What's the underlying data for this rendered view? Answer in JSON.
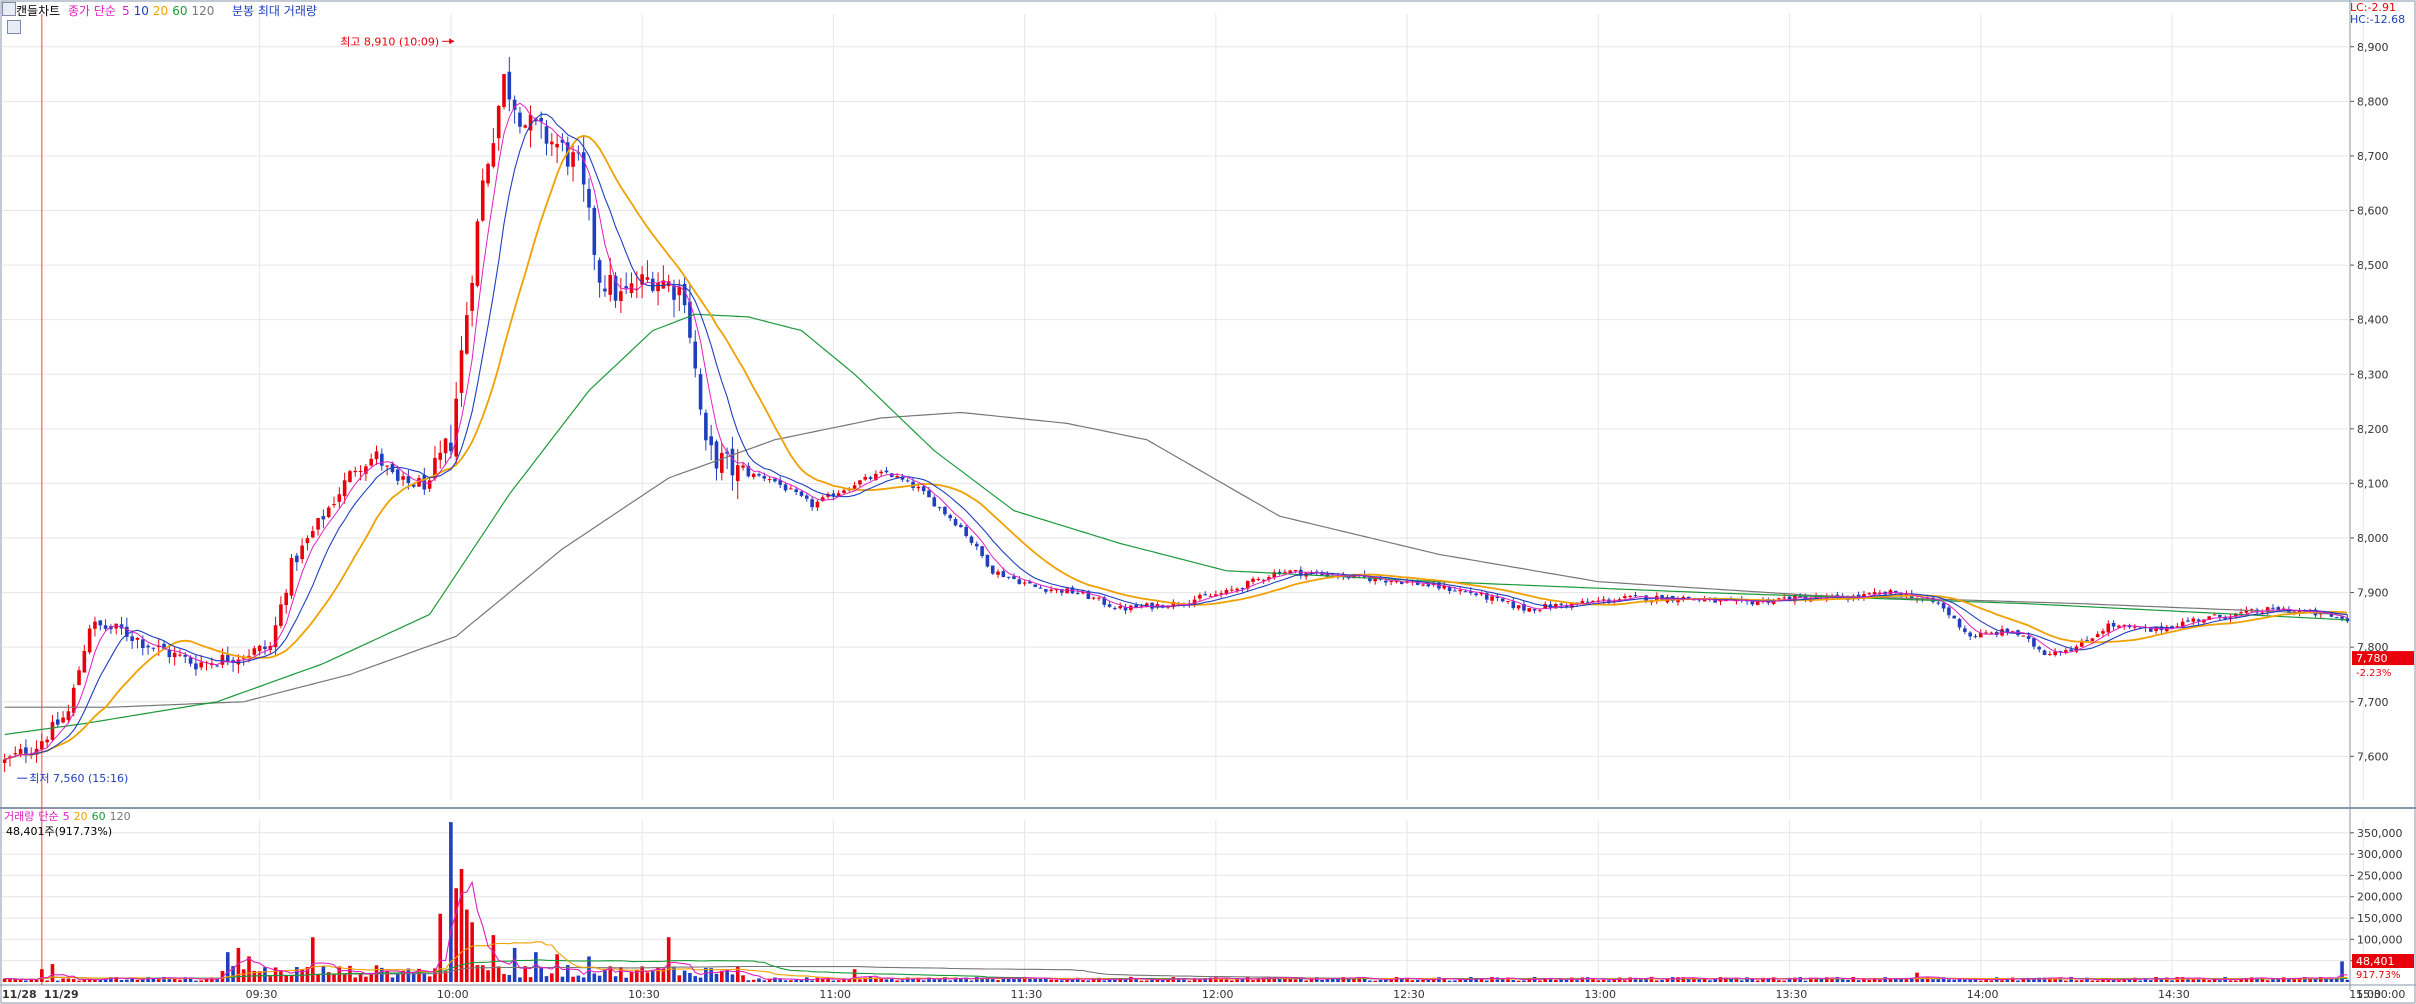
{
  "toolbar": {
    "chart_type_label": "캔들차트",
    "price_ma_label": "종가 단순",
    "price_ma_periods": [
      "5",
      "10",
      "20",
      "60",
      "120"
    ],
    "extra_label": "분봉 최대 거래량",
    "lc": "LC:-2.91",
    "hc": "HC:-12.68"
  },
  "volume_header": {
    "label": "거래량",
    "ma_label": "단순",
    "periods": [
      "5",
      "20",
      "60",
      "120"
    ],
    "value_text": "48,401주(917.73%)"
  },
  "colors": {
    "up": "#e8000b",
    "down": "#1f3fbf",
    "ma5": "#e020c0",
    "ma10": "#1f3fbf",
    "ma20": "#f0a000",
    "ma60": "#1a9a3a",
    "ma120": "#777777",
    "grid": "#e6e6e6",
    "vline": "#ff4040"
  },
  "chart_data": [
    {
      "type": "candlestick",
      "name": "price",
      "ylim": [
        7520,
        8960
      ],
      "y_ticks": [
        "8,900",
        "8,800",
        "8,700",
        "8,600",
        "8,500",
        "8,400",
        "8,300",
        "8,200",
        "8,100",
        "8,000",
        "7,900",
        "7,800",
        "7,700",
        "7,600"
      ],
      "y_tick_values": [
        8900,
        8800,
        8700,
        8600,
        8500,
        8400,
        8300,
        8200,
        8100,
        8000,
        7900,
        7800,
        7700,
        7600
      ],
      "x_labels": [
        "11/28",
        "11/29",
        "09:30",
        "10:00",
        "10:30",
        "11:00",
        "11:30",
        "12:00",
        "12:30",
        "13:00",
        "13:30",
        "14:00",
        "14:30",
        "15:00",
        "15:30:00"
      ],
      "anchors": [
        {
          "t": 0,
          "v": 7590
        },
        {
          "t": 6,
          "v": 7620
        },
        {
          "t": 12,
          "v": 7680
        },
        {
          "t": 16,
          "v": 7840
        },
        {
          "t": 22,
          "v": 7830
        },
        {
          "t": 28,
          "v": 7800
        },
        {
          "t": 36,
          "v": 7770
        },
        {
          "t": 42,
          "v": 7780
        },
        {
          "t": 50,
          "v": 7800
        },
        {
          "t": 54,
          "v": 7950
        },
        {
          "t": 60,
          "v": 8040
        },
        {
          "t": 66,
          "v": 8130
        },
        {
          "t": 70,
          "v": 8150
        },
        {
          "t": 74,
          "v": 8100
        },
        {
          "t": 80,
          "v": 8100
        },
        {
          "t": 84,
          "v": 8180
        },
        {
          "t": 90,
          "v": 8650
        },
        {
          "t": 94,
          "v": 8840
        },
        {
          "t": 98,
          "v": 8760
        },
        {
          "t": 104,
          "v": 8720
        },
        {
          "t": 108,
          "v": 8680
        },
        {
          "t": 112,
          "v": 8480
        },
        {
          "t": 116,
          "v": 8440
        },
        {
          "t": 122,
          "v": 8480
        },
        {
          "t": 128,
          "v": 8450
        },
        {
          "t": 132,
          "v": 8160
        },
        {
          "t": 138,
          "v": 8120
        },
        {
          "t": 144,
          "v": 8110
        },
        {
          "t": 152,
          "v": 8060
        },
        {
          "t": 160,
          "v": 8100
        },
        {
          "t": 166,
          "v": 8120
        },
        {
          "t": 172,
          "v": 8090
        },
        {
          "t": 180,
          "v": 8020
        },
        {
          "t": 186,
          "v": 7940
        },
        {
          "t": 194,
          "v": 7910
        },
        {
          "t": 202,
          "v": 7900
        },
        {
          "t": 210,
          "v": 7870
        },
        {
          "t": 220,
          "v": 7880
        },
        {
          "t": 230,
          "v": 7900
        },
        {
          "t": 240,
          "v": 7940
        },
        {
          "t": 252,
          "v": 7930
        },
        {
          "t": 264,
          "v": 7920
        },
        {
          "t": 276,
          "v": 7900
        },
        {
          "t": 286,
          "v": 7870
        },
        {
          "t": 296,
          "v": 7880
        },
        {
          "t": 306,
          "v": 7890
        },
        {
          "t": 316,
          "v": 7890
        },
        {
          "t": 326,
          "v": 7880
        },
        {
          "t": 336,
          "v": 7890
        },
        {
          "t": 346,
          "v": 7890
        },
        {
          "t": 356,
          "v": 7900
        },
        {
          "t": 364,
          "v": 7880
        },
        {
          "t": 370,
          "v": 7820
        },
        {
          "t": 378,
          "v": 7830
        },
        {
          "t": 384,
          "v": 7790
        },
        {
          "t": 390,
          "v": 7800
        },
        {
          "t": 396,
          "v": 7840
        },
        {
          "t": 404,
          "v": 7830
        },
        {
          "t": 412,
          "v": 7850
        },
        {
          "t": 420,
          "v": 7860
        },
        {
          "t": 428,
          "v": 7870
        },
        {
          "t": 436,
          "v": 7860
        },
        {
          "t": 441,
          "v": 7850
        }
      ],
      "ma60": [
        {
          "t": 0,
          "v": 7640
        },
        {
          "t": 15,
          "v": 7660
        },
        {
          "t": 40,
          "v": 7700
        },
        {
          "t": 60,
          "v": 7770
        },
        {
          "t": 80,
          "v": 7860
        },
        {
          "t": 95,
          "v": 8080
        },
        {
          "t": 110,
          "v": 8270
        },
        {
          "t": 122,
          "v": 8380
        },
        {
          "t": 130,
          "v": 8410
        },
        {
          "t": 140,
          "v": 8405
        },
        {
          "t": 150,
          "v": 8380
        },
        {
          "t": 160,
          "v": 8300
        },
        {
          "t": 175,
          "v": 8160
        },
        {
          "t": 190,
          "v": 8050
        },
        {
          "t": 210,
          "v": 7990
        },
        {
          "t": 230,
          "v": 7940
        },
        {
          "t": 270,
          "v": 7920
        },
        {
          "t": 320,
          "v": 7900
        },
        {
          "t": 380,
          "v": 7880
        },
        {
          "t": 441,
          "v": 7850
        }
      ],
      "ma120": [
        {
          "t": 0,
          "v": 7690
        },
        {
          "t": 20,
          "v": 7690
        },
        {
          "t": 45,
          "v": 7700
        },
        {
          "t": 65,
          "v": 7750
        },
        {
          "t": 85,
          "v": 7820
        },
        {
          "t": 105,
          "v": 7980
        },
        {
          "t": 125,
          "v": 8110
        },
        {
          "t": 145,
          "v": 8180
        },
        {
          "t": 165,
          "v": 8220
        },
        {
          "t": 180,
          "v": 8230
        },
        {
          "t": 200,
          "v": 8210
        },
        {
          "t": 215,
          "v": 8180
        },
        {
          "t": 240,
          "v": 8040
        },
        {
          "t": 270,
          "v": 7970
        },
        {
          "t": 300,
          "v": 7920
        },
        {
          "t": 340,
          "v": 7895
        },
        {
          "t": 390,
          "v": 7880
        },
        {
          "t": 441,
          "v": 7860
        }
      ],
      "high_marker": {
        "text": "최고 8,910 (10:09)",
        "t": 85,
        "v": 8910
      },
      "low_marker": {
        "text": "최저 7,560 (15:16)",
        "t": 2,
        "v": 7560
      },
      "last_price": {
        "value": 7780,
        "text": "7,780",
        "change": "-2.23%"
      }
    },
    {
      "type": "bar",
      "name": "volume",
      "ylim": [
        0,
        380000
      ],
      "y_ticks": [
        "350,000",
        "300,000",
        "250,000",
        "200,000",
        "150,000",
        "100,000",
        "50,000"
      ],
      "y_tick_values": [
        350000,
        300000,
        250000,
        200000,
        150000,
        100000,
        50000
      ],
      "spikes": [
        {
          "t": 7,
          "v": 30000
        },
        {
          "t": 9,
          "v": 42000
        },
        {
          "t": 42,
          "v": 70000
        },
        {
          "t": 44,
          "v": 80000
        },
        {
          "t": 46,
          "v": 60000
        },
        {
          "t": 58,
          "v": 105000
        },
        {
          "t": 82,
          "v": 160000
        },
        {
          "t": 84,
          "v": 375000
        },
        {
          "t": 85,
          "v": 220000
        },
        {
          "t": 86,
          "v": 265000
        },
        {
          "t": 87,
          "v": 170000
        },
        {
          "t": 88,
          "v": 140000
        },
        {
          "t": 92,
          "v": 110000
        },
        {
          "t": 96,
          "v": 80000
        },
        {
          "t": 100,
          "v": 70000
        },
        {
          "t": 104,
          "v": 65000
        },
        {
          "t": 110,
          "v": 60000
        },
        {
          "t": 125,
          "v": 105000
        },
        {
          "t": 160,
          "v": 30000
        },
        {
          "t": 360,
          "v": 22000
        },
        {
          "t": 440,
          "v": 48401
        }
      ],
      "last_value": {
        "text": "48,401",
        "pct": "917.73%"
      }
    }
  ]
}
